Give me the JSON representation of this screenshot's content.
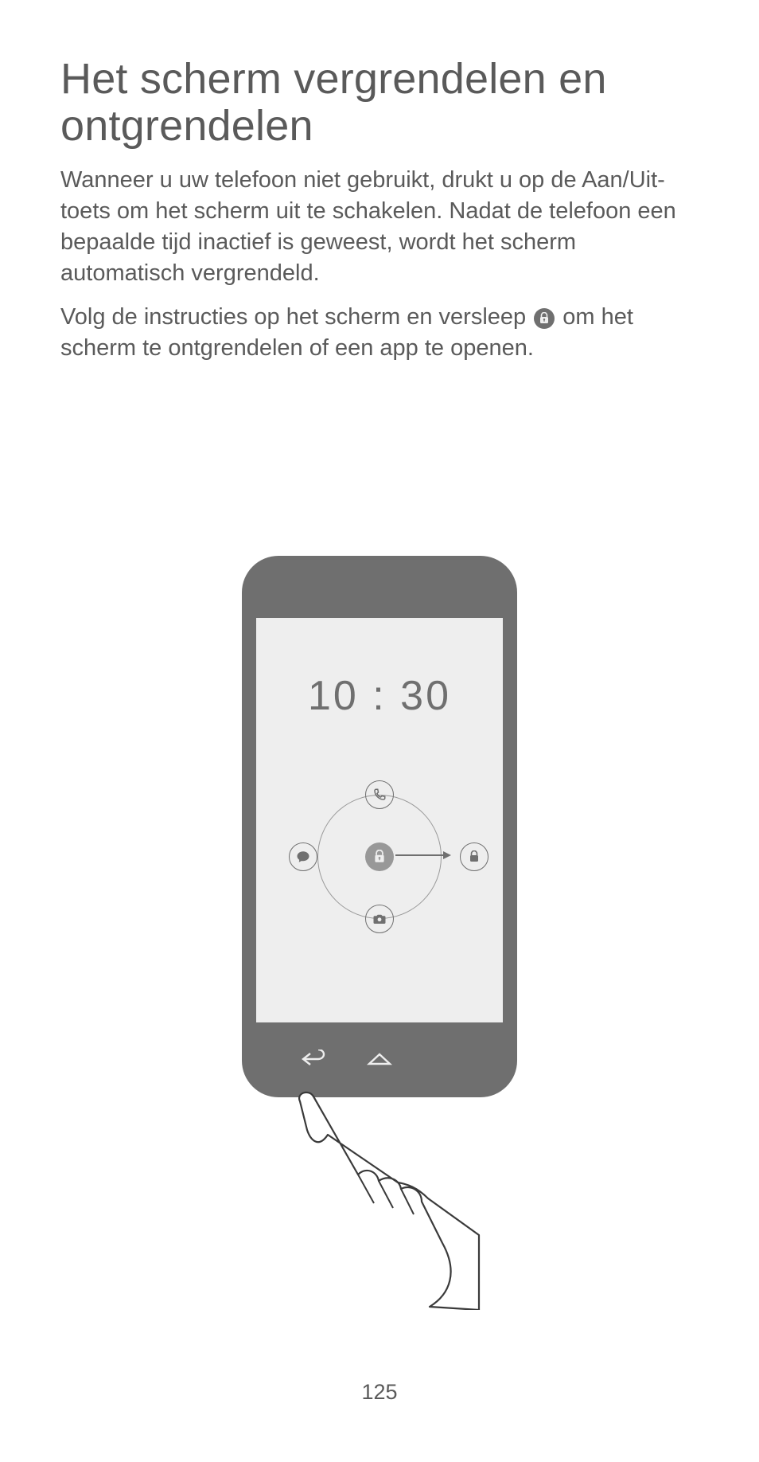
{
  "title": "Het scherm vergrendelen en ontgrendelen",
  "p1": "Wanneer u uw telefoon niet gebruikt, drukt u op de Aan/Uit-toets om het scherm uit te schakelen. Nadat de telefoon een bepaalde tijd inactief is geweest, wordt het scherm automatisch vergrendeld.",
  "p2a": "Volg de instructies op het scherm en versleep ",
  "p2b": " om het scherm te ontgrendelen of een app te openen.",
  "illustration": {
    "time": "10 : 30"
  },
  "page_number": "125"
}
